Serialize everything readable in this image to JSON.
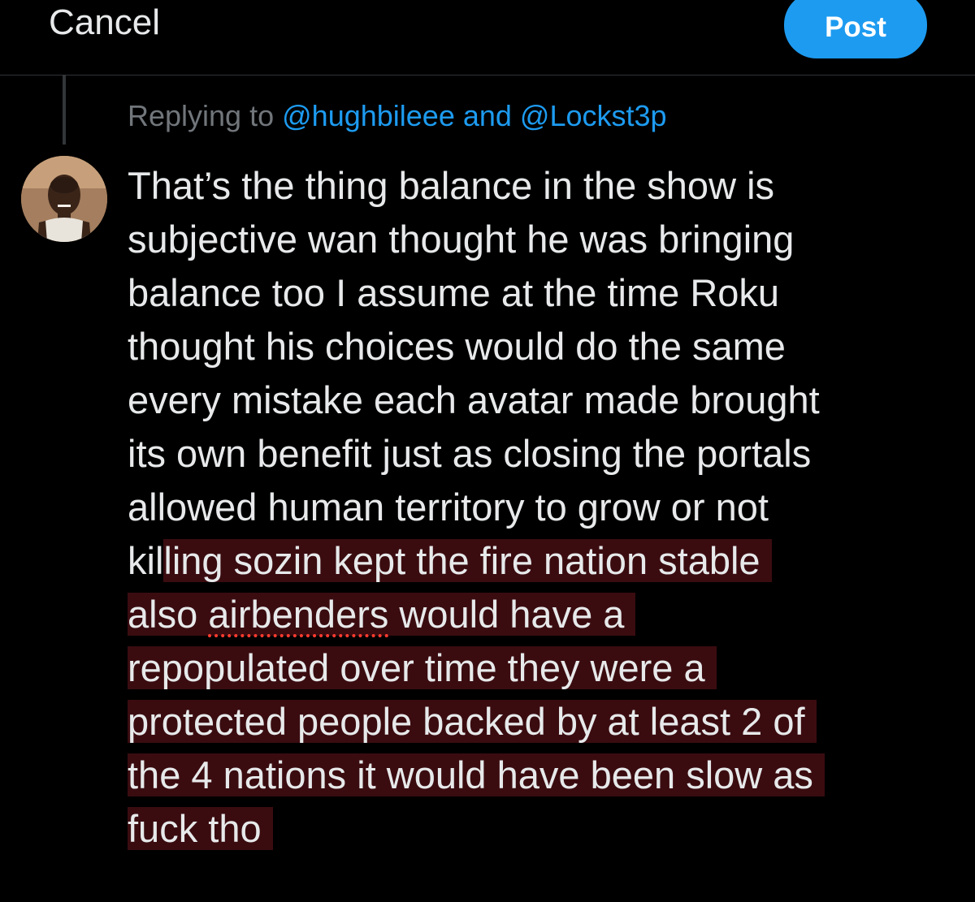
{
  "header": {
    "cancel_label": "Cancel",
    "post_label": "Post"
  },
  "reply": {
    "prefix": "Replying to",
    "mentions": "@hughbileee and @Lockst3p"
  },
  "tweet": {
    "lines": [
      {
        "plain": "That’s the thing balance in the show is"
      },
      {
        "plain": "subjective wan thought he was bringing"
      },
      {
        "plain": "balance too I assume at the time Roku"
      },
      {
        "plain": "thought his choices would do the same"
      },
      {
        "plain": "every mistake each avatar made brought"
      },
      {
        "plain": "its own benefit just as closing the portals"
      },
      {
        "plain": "allowed human territory to grow or not"
      },
      {
        "plain": "kil",
        "highlight": "ling sozin kept the fire nation stable"
      },
      {
        "highlight": "also ",
        "misspelled": "airbenders",
        "rest": " would have a"
      },
      {
        "highlight": "repopulated over time they were a"
      },
      {
        "highlight": "protected people backed by at least 2 of"
      },
      {
        "highlight": "the 4 nations it would have been slow as"
      },
      {
        "highlight": "fuck tho"
      }
    ]
  },
  "colors": {
    "background": "#000000",
    "text": "#e7e9ea",
    "muted": "#71767b",
    "accent": "#1d9bf0",
    "highlight": "#3a0c10",
    "spellcheck": "#ff3b30"
  },
  "icons": {
    "avatar": "user-avatar-photo"
  }
}
